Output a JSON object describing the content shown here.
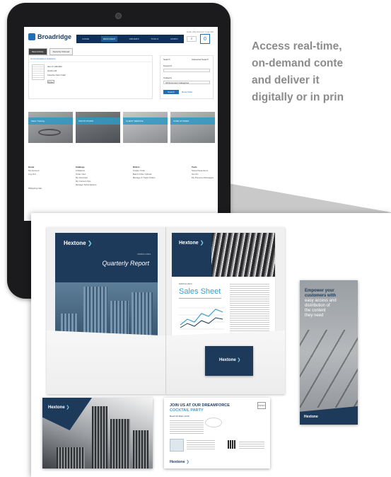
{
  "headline": {
    "lines": [
      "Access real-time,",
      "on-demand conte",
      "and deliver it",
      "digitally or in prin"
    ]
  },
  "tablet": {
    "top_links": "Hello | My Account | Log Out",
    "logo": "Broadridge",
    "nav": [
      "HOME",
      "DESIGNER",
      "ORDERS",
      "TOOLS",
      "ADMIN"
    ],
    "active_nav": "DESIGNER",
    "search_icon": "search-icon",
    "cart_icon": "cart-icon",
    "cart_count": "0",
    "tabs": [
      "Most Activity",
      "Recently Ordered"
    ],
    "panel_heading": "Communications Solutions",
    "item_lines": [
      "Item # 1001922",
      "Quick edit",
      "Favorite  New  Order"
    ],
    "item_button": "Order",
    "search_panel": {
      "label": "Search",
      "toggle": "Advanced Search",
      "keyword_label": "Keyword",
      "category_label": "Category",
      "category_value": "All Document Categories",
      "button": "Search",
      "reset": "Reset Filter"
    },
    "tiles": [
      "Sales Training",
      "INSTITUTIONS",
      "CLIENT SERVICE",
      "CASE STUDIES"
    ],
    "footer": [
      {
        "heading": "Home",
        "items": [
          "My Account",
          "Log Out"
        ]
      },
      {
        "heading": "Catalogs",
        "items": [
          "Collateral",
          "Order Now",
          "My Favorites",
          "My Content Ops",
          "Manage Subscriptions"
        ]
      },
      {
        "heading": "Orders",
        "items": [
          "Create Order",
          "Batch Order Upload",
          "Manage & Track Orders"
        ]
      },
      {
        "heading": "Tools",
        "items": [
          "Saved Selections",
          "Get Fix",
          "My Previous Messages"
        ]
      }
    ],
    "shopping": "Shopping Cart"
  },
  "samples": {
    "brand": "Hextone",
    "quarterly_report": {
      "date": "MARCH 2024",
      "title": "Quarterly Report"
    },
    "sales_sheet": {
      "date": "MARCH 2024",
      "title": "Sales Sheet"
    },
    "banner": {
      "lines": [
        "Empower your",
        "customers with",
        "easy access and",
        "distribution of",
        "the content",
        "they need"
      ],
      "highlight_words": [
        "Empower your",
        "customers"
      ]
    },
    "postcard": {
      "line1": "JOIN US AT OUR DREAMFORCE",
      "line2": "COCKTAIL PARTY",
      "stamp": "PRSRT",
      "date": "Booth #4 Main 10:30"
    }
  },
  "colors": {
    "brand_navy": "#1e3a5b",
    "accent_blue": "#3a9fce",
    "headline_gray": "#8b8b8b",
    "nav_navy": "#0f3058",
    "teal_caption": "#2f99c4"
  }
}
